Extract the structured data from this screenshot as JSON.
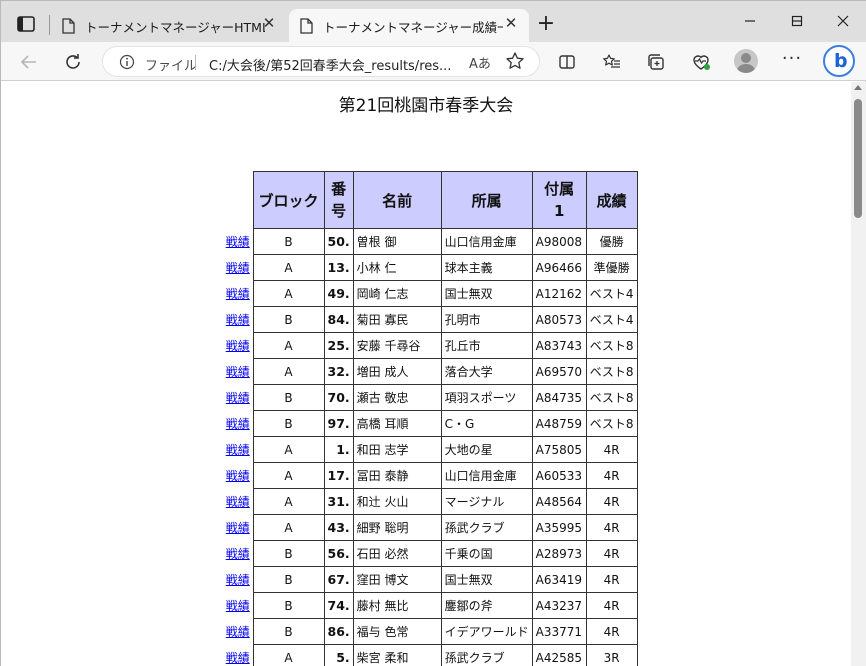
{
  "tabs": [
    {
      "title": "トーナメントマネージャーHTMLファイル",
      "close": "✕"
    },
    {
      "title": "トーナメントマネージャー成績一覧",
      "close": "✕"
    }
  ],
  "new_tab": "+",
  "address_bar": {
    "scheme_label": "ファイル",
    "url": "C:/大会後/第52回春季大会_results/res...",
    "read_aloud": "Aあ"
  },
  "more_label": "···",
  "bing_label": "b",
  "page": {
    "title": "第21回桃園市春季大会",
    "headers": {
      "block": "ブロック",
      "number": "番号",
      "name": "名前",
      "org": "所属",
      "attached": "付属1",
      "result": "成績"
    },
    "rows": [
      {
        "link": "戦績",
        "block": "B",
        "number": "50.",
        "name": "曽根 御",
        "org": "山口信用金庫",
        "attached": "A98008",
        "result": "優勝"
      },
      {
        "link": "戦績",
        "block": "A",
        "number": "13.",
        "name": "小林 仁",
        "org": "球本主義",
        "attached": "A96466",
        "result": "準優勝"
      },
      {
        "link": "戦績",
        "block": "A",
        "number": "49.",
        "name": "岡崎 仁志",
        "org": "国士無双",
        "attached": "A12162",
        "result": "ベスト4"
      },
      {
        "link": "戦績",
        "block": "B",
        "number": "84.",
        "name": "菊田 寡民",
        "org": "孔明市",
        "attached": "A80573",
        "result": "ベスト4"
      },
      {
        "link": "戦績",
        "block": "A",
        "number": "25.",
        "name": "安藤 千尋谷",
        "org": "孔丘市",
        "attached": "A83743",
        "result": "ベスト8"
      },
      {
        "link": "戦績",
        "block": "A",
        "number": "32.",
        "name": "増田 成人",
        "org": "落合大学",
        "attached": "A69570",
        "result": "ベスト8"
      },
      {
        "link": "戦績",
        "block": "B",
        "number": "70.",
        "name": "瀬古 敬忠",
        "org": "項羽スポーツ",
        "attached": "A84735",
        "result": "ベスト8"
      },
      {
        "link": "戦績",
        "block": "B",
        "number": "97.",
        "name": "高橋 耳順",
        "org": "C・G",
        "attached": "A48759",
        "result": "ベスト8"
      },
      {
        "link": "戦績",
        "block": "A",
        "number": "1.",
        "name": "和田 志学",
        "org": "大地の星",
        "attached": "A75805",
        "result": "4R"
      },
      {
        "link": "戦績",
        "block": "A",
        "number": "17.",
        "name": "冨田 泰静",
        "org": "山口信用金庫",
        "attached": "A60533",
        "result": "4R"
      },
      {
        "link": "戦績",
        "block": "A",
        "number": "31.",
        "name": "和辻 火山",
        "org": "マージナル",
        "attached": "A48564",
        "result": "4R"
      },
      {
        "link": "戦績",
        "block": "A",
        "number": "43.",
        "name": "細野 聡明",
        "org": "孫武クラブ",
        "attached": "A35995",
        "result": "4R"
      },
      {
        "link": "戦績",
        "block": "B",
        "number": "56.",
        "name": "石田 必然",
        "org": "千乗の国",
        "attached": "A28973",
        "result": "4R"
      },
      {
        "link": "戦績",
        "block": "B",
        "number": "67.",
        "name": "窪田 博文",
        "org": "国士無双",
        "attached": "A63419",
        "result": "4R"
      },
      {
        "link": "戦績",
        "block": "B",
        "number": "74.",
        "name": "藤村 無比",
        "org": "鏖鄒の斧",
        "attached": "A43237",
        "result": "4R"
      },
      {
        "link": "戦績",
        "block": "B",
        "number": "86.",
        "name": "福与 色常",
        "org": "イデアワールド",
        "attached": "A33771",
        "result": "4R"
      },
      {
        "link": "戦績",
        "block": "A",
        "number": "5.",
        "name": "柴宮 柔和",
        "org": "孫武クラブ",
        "attached": "A42585",
        "result": "3R"
      }
    ]
  },
  "colors": {
    "header_bg": "#ccccff",
    "link": "#0000ee",
    "bing": "#1b63d6"
  }
}
